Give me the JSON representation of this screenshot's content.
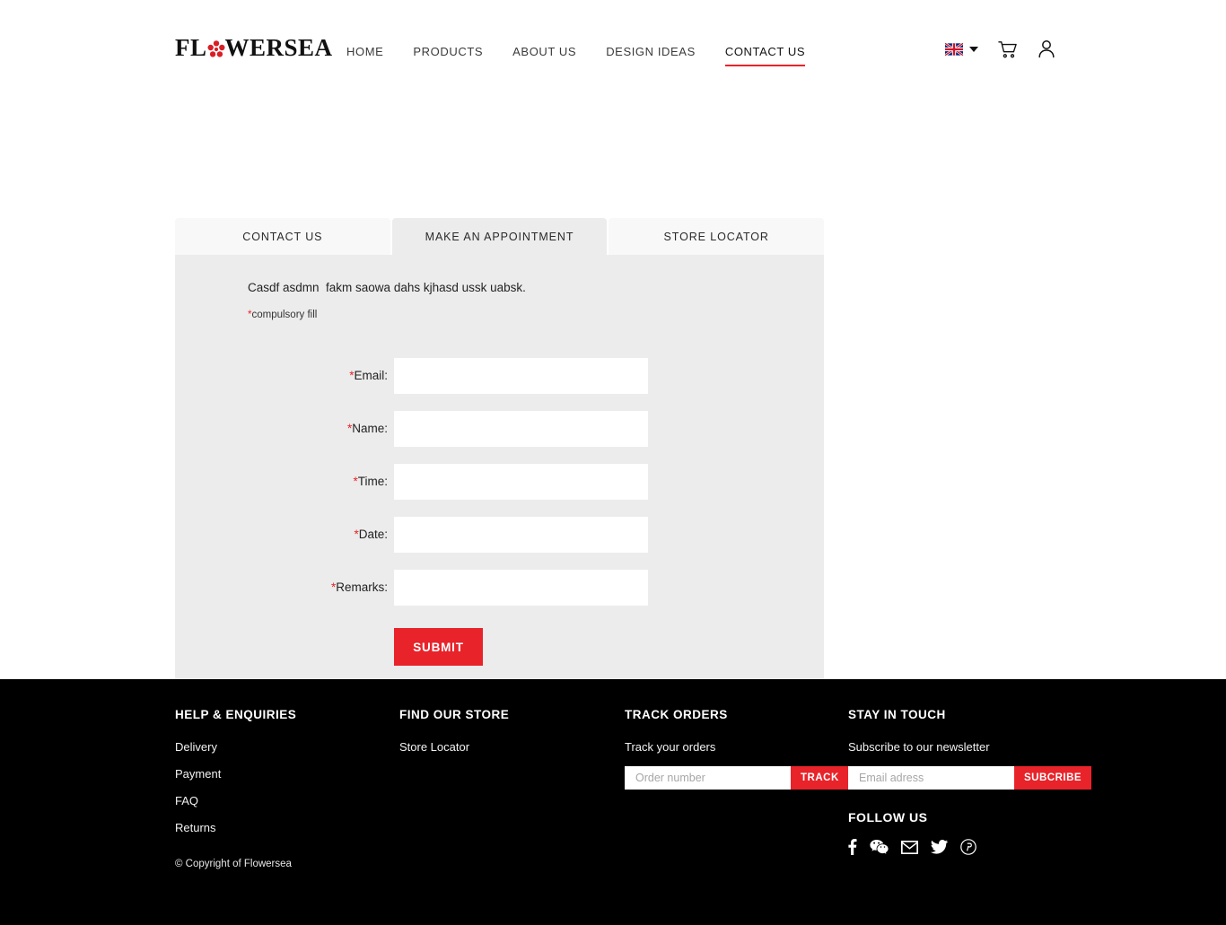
{
  "brand": {
    "name_before": "FL",
    "name_after": "WERSEA",
    "rose_icon": "rose-icon",
    "accent_color": "#e8232a"
  },
  "nav": {
    "items": [
      {
        "label": "HOME",
        "active": false
      },
      {
        "label": "PRODUCTS",
        "active": false
      },
      {
        "label": "ABOUT US",
        "active": false
      },
      {
        "label": "DESIGN IDEAS",
        "active": false
      },
      {
        "label": "CONTACT US",
        "active": true
      }
    ]
  },
  "header_tools": {
    "language_flag": "uk-flag-icon",
    "language_caret": "chevron-down-icon",
    "cart": "cart-icon",
    "account": "user-icon"
  },
  "tabs": [
    {
      "label": "CONTACT US",
      "active": false
    },
    {
      "label": "MAKE AN APPOINTMENT",
      "active": true
    },
    {
      "label": "STORE LOCATOR",
      "active": false
    }
  ],
  "form": {
    "intro": "Casdf asdmn  fakm saowa dahs kjhasd ussk uabsk.",
    "compulsory_star": "*",
    "compulsory_note": "compulsory fill",
    "fields": [
      {
        "star": "*",
        "label": "Email:",
        "value": "",
        "placeholder": ""
      },
      {
        "star": "*",
        "label": "Name:",
        "value": "",
        "placeholder": ""
      },
      {
        "star": "*",
        "label": "Time:",
        "value": "",
        "placeholder": ""
      },
      {
        "star": "*",
        "label": "Date:",
        "value": "",
        "placeholder": ""
      },
      {
        "star": "*",
        "label": "Remarks:",
        "value": "",
        "placeholder": ""
      }
    ],
    "submit_label": "SUBMIT"
  },
  "footer": {
    "help": {
      "heading": "HELP & ENQUIRIES",
      "links": [
        "Delivery",
        "Payment",
        "FAQ",
        "Returns"
      ]
    },
    "store": {
      "heading": "FIND OUR STORE",
      "links": [
        "Store Locator"
      ]
    },
    "track": {
      "heading": "TRACK ORDERS",
      "text": "Track your orders",
      "placeholder": "Order number",
      "value": "",
      "button": "TRACK"
    },
    "touch": {
      "heading": "STAY IN TOUCH",
      "text": "Subscribe to our newsletter",
      "placeholder": "Email adress",
      "value": "",
      "button": "SUBCRIBE"
    },
    "follow": {
      "heading": "FOLLOW US",
      "icons": [
        "facebook-icon",
        "wechat-icon",
        "email-icon",
        "twitter-icon",
        "pinterest-icon"
      ]
    },
    "copyright": "© Copyright of Flowersea"
  }
}
